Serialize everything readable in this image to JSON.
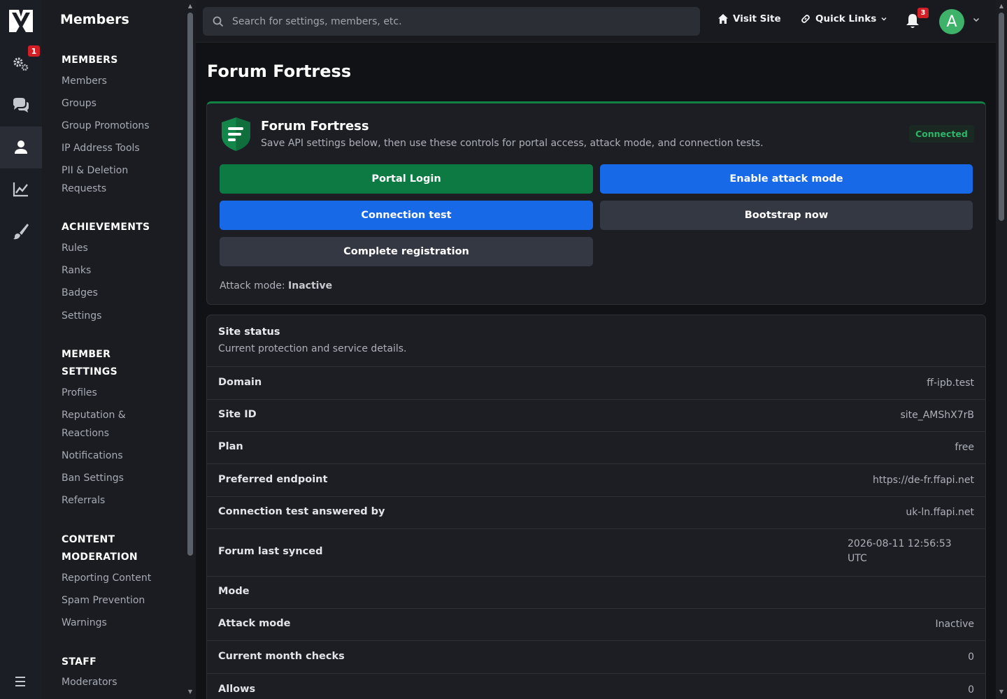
{
  "sidebar": {
    "title": "Members",
    "sections": [
      {
        "heading": "MEMBERS",
        "links": [
          "Members",
          "Groups",
          "Group Promotions",
          "IP Address Tools",
          "PII & Deletion Requests"
        ]
      },
      {
        "heading": "ACHIEVEMENTS",
        "links": [
          "Rules",
          "Ranks",
          "Badges",
          "Settings"
        ]
      },
      {
        "heading": "MEMBER SETTINGS",
        "links": [
          "Profiles",
          "Reputation & Reactions",
          "Notifications",
          "Ban Settings",
          "Referrals"
        ]
      },
      {
        "heading": "CONTENT MODERATION",
        "links": [
          "Reporting Content",
          "Spam Prevention",
          "Warnings"
        ]
      },
      {
        "heading": "STAFF",
        "links": [
          "Moderators"
        ]
      }
    ]
  },
  "rail": {
    "settings_badge": "1",
    "icons": [
      "logo-icon",
      "gears-icon",
      "chat-icon",
      "user-icon",
      "chart-icon",
      "brush-icon",
      "menu-icon"
    ]
  },
  "topbar": {
    "search_placeholder": "Search for settings, members, etc.",
    "visit_site": "Visit Site",
    "quick_links": "Quick Links",
    "notifications_count": "3",
    "avatar_letter": "A"
  },
  "page": {
    "title": "Forum Fortress"
  },
  "fortress": {
    "name": "Forum Fortress",
    "description": "Save API settings below, then use these controls for portal access, attack mode, and connection tests.",
    "status": "Connected",
    "buttons": {
      "portal_login": "Portal Login",
      "enable_attack": "Enable attack mode",
      "connection_test": "Connection test",
      "bootstrap": "Bootstrap now",
      "complete_registration": "Complete registration"
    },
    "attack_mode_label": "Attack mode:",
    "attack_mode_value": "Inactive"
  },
  "site_status": {
    "title": "Site status",
    "subtitle": "Current protection and service details.",
    "rows": [
      {
        "key": "Domain",
        "value": "ff-ipb.test"
      },
      {
        "key": "Site ID",
        "value": "site_AMShX7rB"
      },
      {
        "key": "Plan",
        "value": "free"
      },
      {
        "key": "Preferred endpoint",
        "value": "https://de-fr.ffapi.net"
      },
      {
        "key": "Connection test answered by",
        "value": "uk-ln.ffapi.net"
      },
      {
        "key": "Forum last synced",
        "value": "2026-08-11 12:56:53 UTC"
      },
      {
        "key": "Mode",
        "value": ""
      },
      {
        "key": "Attack mode",
        "value": "Inactive"
      },
      {
        "key": "Current month checks",
        "value": "0"
      },
      {
        "key": "Allows",
        "value": "0"
      }
    ]
  },
  "colors": {
    "accent_green": "#0e7a43",
    "accent_blue": "#1769e8",
    "badge_red": "#d21f26",
    "status_green": "#2eb56a"
  }
}
